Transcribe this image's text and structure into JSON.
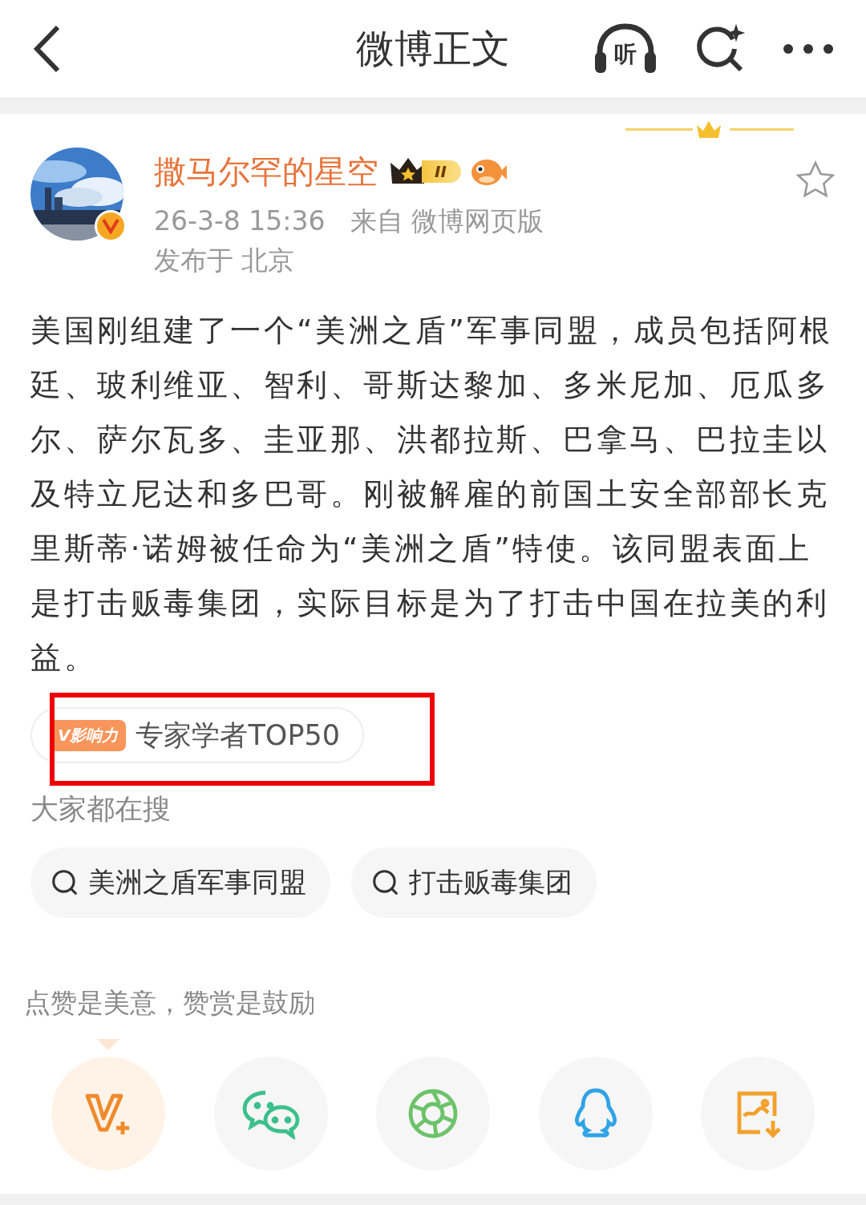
{
  "header": {
    "title": "微博正文",
    "listen_label": "听"
  },
  "post": {
    "author": {
      "name": "撒马尔罕的星空",
      "verified": true,
      "level_badge": "II"
    },
    "time": "26-3-8 15:36",
    "source": "来自 微博网页版",
    "location": "发布于 北京",
    "favorited": false,
    "body": "美国刚组建了一个“美洲之盾”军事同盟，成员包括阿根廷、玻利维亚、智利、哥斯达黎加、多米尼加、厄瓜多尔、萨尔瓦多、圭亚那、洪都拉斯、巴拿马、巴拉圭以及特立尼达和多巴哥。刚被解雇的前国土安全部部长克里斯蒂·诺姆被任命为“美洲之盾”特使。该同盟表面上是打击贩毒集团，实际目标是为了打击中国在拉美的利益。",
    "influence_tag": {
      "badge": "V影响力",
      "label": "专家学者TOP50",
      "highlighted": true
    }
  },
  "trending": {
    "title": "大家都在搜",
    "items": [
      "美洲之盾军事同盟",
      "打击贩毒集团"
    ]
  },
  "reward": {
    "prompt": "点赞是美意，赞赏是鼓励",
    "share_targets": [
      {
        "kind": "vplus",
        "selected": true
      },
      {
        "kind": "wechat",
        "selected": false
      },
      {
        "kind": "moments",
        "selected": false
      },
      {
        "kind": "qq",
        "selected": false
      },
      {
        "kind": "save-image",
        "selected": false
      }
    ]
  }
}
